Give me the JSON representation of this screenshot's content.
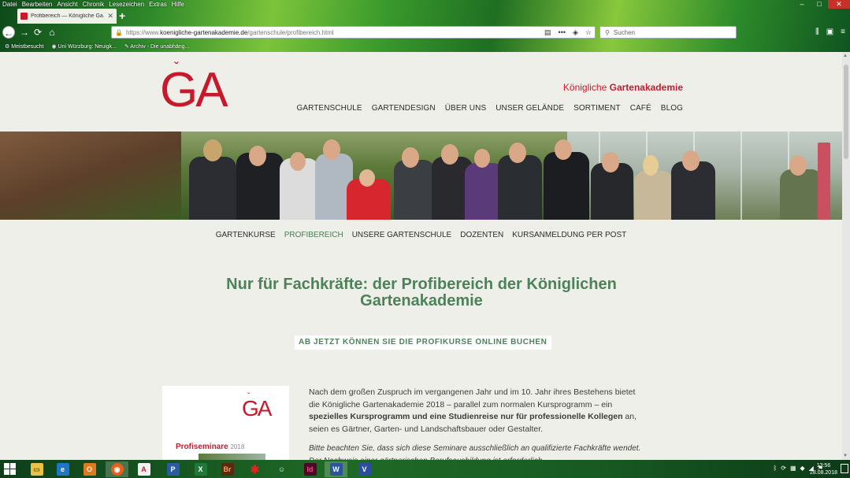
{
  "browser": {
    "menu": [
      "Datei",
      "Bearbeiten",
      "Ansicht",
      "Chronik",
      "Lesezeichen",
      "Extras",
      "Hilfe"
    ],
    "tab_title": "Profibereich — Königliche Ga...",
    "url_prefix": "https://www.",
    "url_domain": "koenigliche-gartenakademie.de",
    "url_path": "/gartenschule/profibereich.html",
    "search_placeholder": "Suchen",
    "bookmarks": [
      "Meistbesucht",
      "Uni Würzburg: Neuigk...",
      "Archiv - Die unabhäng..."
    ]
  },
  "site": {
    "logo": "GA",
    "brand_prefix": "Königliche ",
    "brand_bold": "Gartenakademie",
    "main_nav": [
      "GARTENSCHULE",
      "GARTENDESIGN",
      "ÜBER UNS",
      "UNSER GELÄNDE",
      "SORTIMENT",
      "CAFÉ",
      "BLOG"
    ],
    "sub_nav": [
      "GARTENKURSE",
      "PROFIBEREICH",
      "UNSERE GARTENSCHULE",
      "DOZENTEN",
      "KURSANMELDUNG PER POST"
    ],
    "sub_nav_active": "PROFIBEREICH",
    "headline": "Nur für Fachkräfte: der Profibereich der Königlichen Gartenakademie",
    "banner": "AB JETZT KÖNNEN SIE DIE PROFIKURSE ONLINE BUCHEN",
    "card_logo": "GA",
    "card_title": "Profiseminare",
    "card_year": "2018",
    "body_1": "Nach dem großen Zuspruch im vergangenen Jahr und im 10. Jahr ihres Bestehens bietet die Königliche Gartenakademie 2018 – parallel zum normalen Kursprogramm – ein ",
    "body_bold": "spezielles Kursprogramm und eine Studienreise nur für professionelle Kollegen",
    "body_2": " an, seien es Gärtner, Garten- und Landschaftsbauer oder Gestalter.",
    "note": "Bitte beachten Sie, dass sich diese Seminare ausschließlich an qualifizierte Fachkräfte wendet. Der Nachweis einer gärtnerischen Berufsausbildung ist erforderlich."
  },
  "taskbar": {
    "apps": [
      "explorer",
      "ie",
      "outlook",
      "access",
      "firefox",
      "acrobat",
      "project",
      "excel",
      "bridge",
      "app-star",
      "app-people",
      "indesign",
      "word",
      "visio"
    ],
    "time": "13:56",
    "date": "28.08.2018"
  },
  "colors": {
    "brand_red": "#c8192c",
    "headline_green": "#4d8159",
    "page_bg": "#efefe9"
  }
}
